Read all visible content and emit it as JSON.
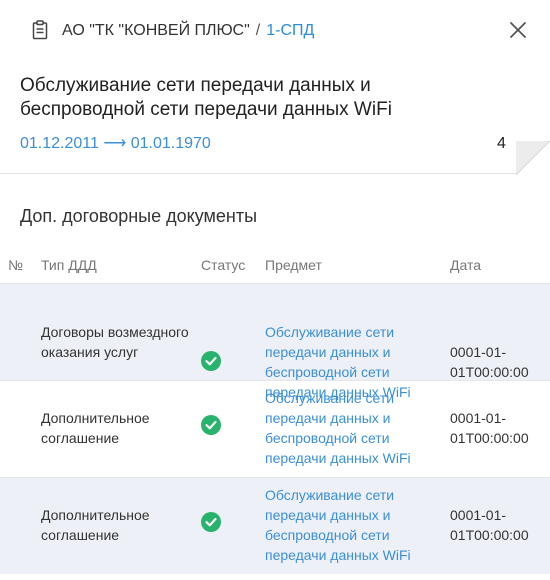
{
  "header": {
    "icon": "clipboard-document-icon",
    "organization": "АО \"ТК \"КОНВЕЙ ПЛЮС\"",
    "separator": "/",
    "code": "1-СПД",
    "close_icon": "close-icon"
  },
  "contract": {
    "title": "Обслуживание сети передачи данных и беспроводной сети передачи данных WiFi",
    "period": "01.12.2011 ⟶ 01.01.1970",
    "count": "4"
  },
  "section": {
    "title": "Доп. договорные документы"
  },
  "table": {
    "columns": {
      "num": "№",
      "type": "Тип ДДД",
      "status": "Статус",
      "subject": "Предмет",
      "date": "Дата"
    },
    "rows": [
      {
        "type": "Договоры возмездного оказания услуг",
        "status_icon": "check-circle-icon",
        "status_color": "#27b36b",
        "subject": "Обслуживание сети передачи данных и беспроводной сети передачи данных WiFi",
        "date": "0001-01-01T00:00:00"
      },
      {
        "type": "Дополнительное соглашение",
        "status_icon": "check-circle-icon",
        "status_color": "#27b36b",
        "subject": "Обслуживание сети передачи данных и беспроводной сети передачи данных WiFi",
        "date": "0001-01-01T00:00:00"
      },
      {
        "type": "Дополнительное соглашение",
        "status_icon": "check-circle-icon",
        "status_color": "#27b36b",
        "subject": "Обслуживание сети передачи данных и беспроводной сети передачи данных WiFi",
        "date": "0001-01-01T00:00:00"
      }
    ]
  },
  "colors": {
    "accent": "#3a8fd8",
    "status_ok": "#27b36b",
    "row_alt": "#eef0f7"
  }
}
